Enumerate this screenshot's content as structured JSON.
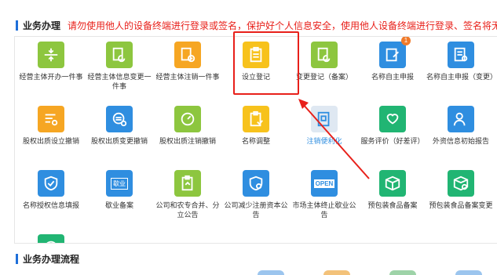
{
  "section1": {
    "title": "业务办理"
  },
  "notice": "请勿使用他人的设备终端进行登录或签名，保护好个人信息安全，使用他人设备终端进行登录、签名将无法提交登记",
  "tiles": [
    {
      "label": "经营主体开办一件事",
      "color": "#8dc63f",
      "icon": "compress-icon"
    },
    {
      "label": "经营主体信息变更一件事",
      "color": "#8dc63f",
      "icon": "doc-refresh-icon"
    },
    {
      "label": "经营主体注销一件事",
      "color": "#f6a623",
      "icon": "doc-cancel-icon"
    },
    {
      "label": "设立登记",
      "color": "#f7c21c",
      "icon": "clipboard-icon"
    },
    {
      "label": "变更登记（备案）",
      "color": "#8dc63f",
      "icon": "doc-refresh-icon"
    },
    {
      "label": "名称自主申报",
      "color": "#2f8ee0",
      "icon": "doc-edit-icon",
      "badge": "1"
    },
    {
      "label": "名称自主申报（变更）",
      "color": "#2f8ee0",
      "icon": "doc-change-icon"
    },
    {
      "label": "股权出质设立撤销",
      "color": "#f6a623",
      "icon": "list-coin-icon"
    },
    {
      "label": "股权出质变更撤销",
      "color": "#2f8ee0",
      "icon": "coin-change-icon"
    },
    {
      "label": "股权出质注销撤销",
      "color": "#8dc63f",
      "icon": "gauge-icon"
    },
    {
      "label": "名称调整",
      "color": "#f7c21c",
      "icon": "clipboard-adjust-icon"
    },
    {
      "label": "注销便利化",
      "color": "#dfe8f2",
      "icon": "doc-stamp-icon"
    },
    {
      "label": "服务评价（好差评）",
      "color": "#21b573",
      "icon": "heart-hand-icon"
    },
    {
      "label": "外资信息初始报告",
      "color": "#2f8ee0",
      "icon": "person-report-icon"
    },
    {
      "label": "名称授权信息填报",
      "color": "#2f8ee0",
      "icon": "shield-check-icon"
    },
    {
      "label": "歇业备案",
      "color": "#2f8ee0",
      "icon": "shop-closed-icon"
    },
    {
      "label": "公司和农专合并、分立公告",
      "color": "#8dc63f",
      "icon": "doc-merge-icon"
    },
    {
      "label": "公司减少注册资本公告",
      "color": "#2f8ee0",
      "icon": "shield-minus-icon"
    },
    {
      "label": "市场主体终止歇业公告",
      "color": "#2f8ee0",
      "icon": "open-sign-icon"
    },
    {
      "label": "预包装食品备案",
      "color": "#21b573",
      "icon": "box-icon"
    },
    {
      "label": "预包装食品备案变更",
      "color": "#21b573",
      "icon": "box-refresh-icon"
    },
    {
      "label": "",
      "color": "#21b573",
      "icon": "clock-icon"
    }
  ],
  "open_sign_text": "OPEN",
  "closed_sign_text": "歇业",
  "section2": {
    "title": "业务办理流程"
  }
}
